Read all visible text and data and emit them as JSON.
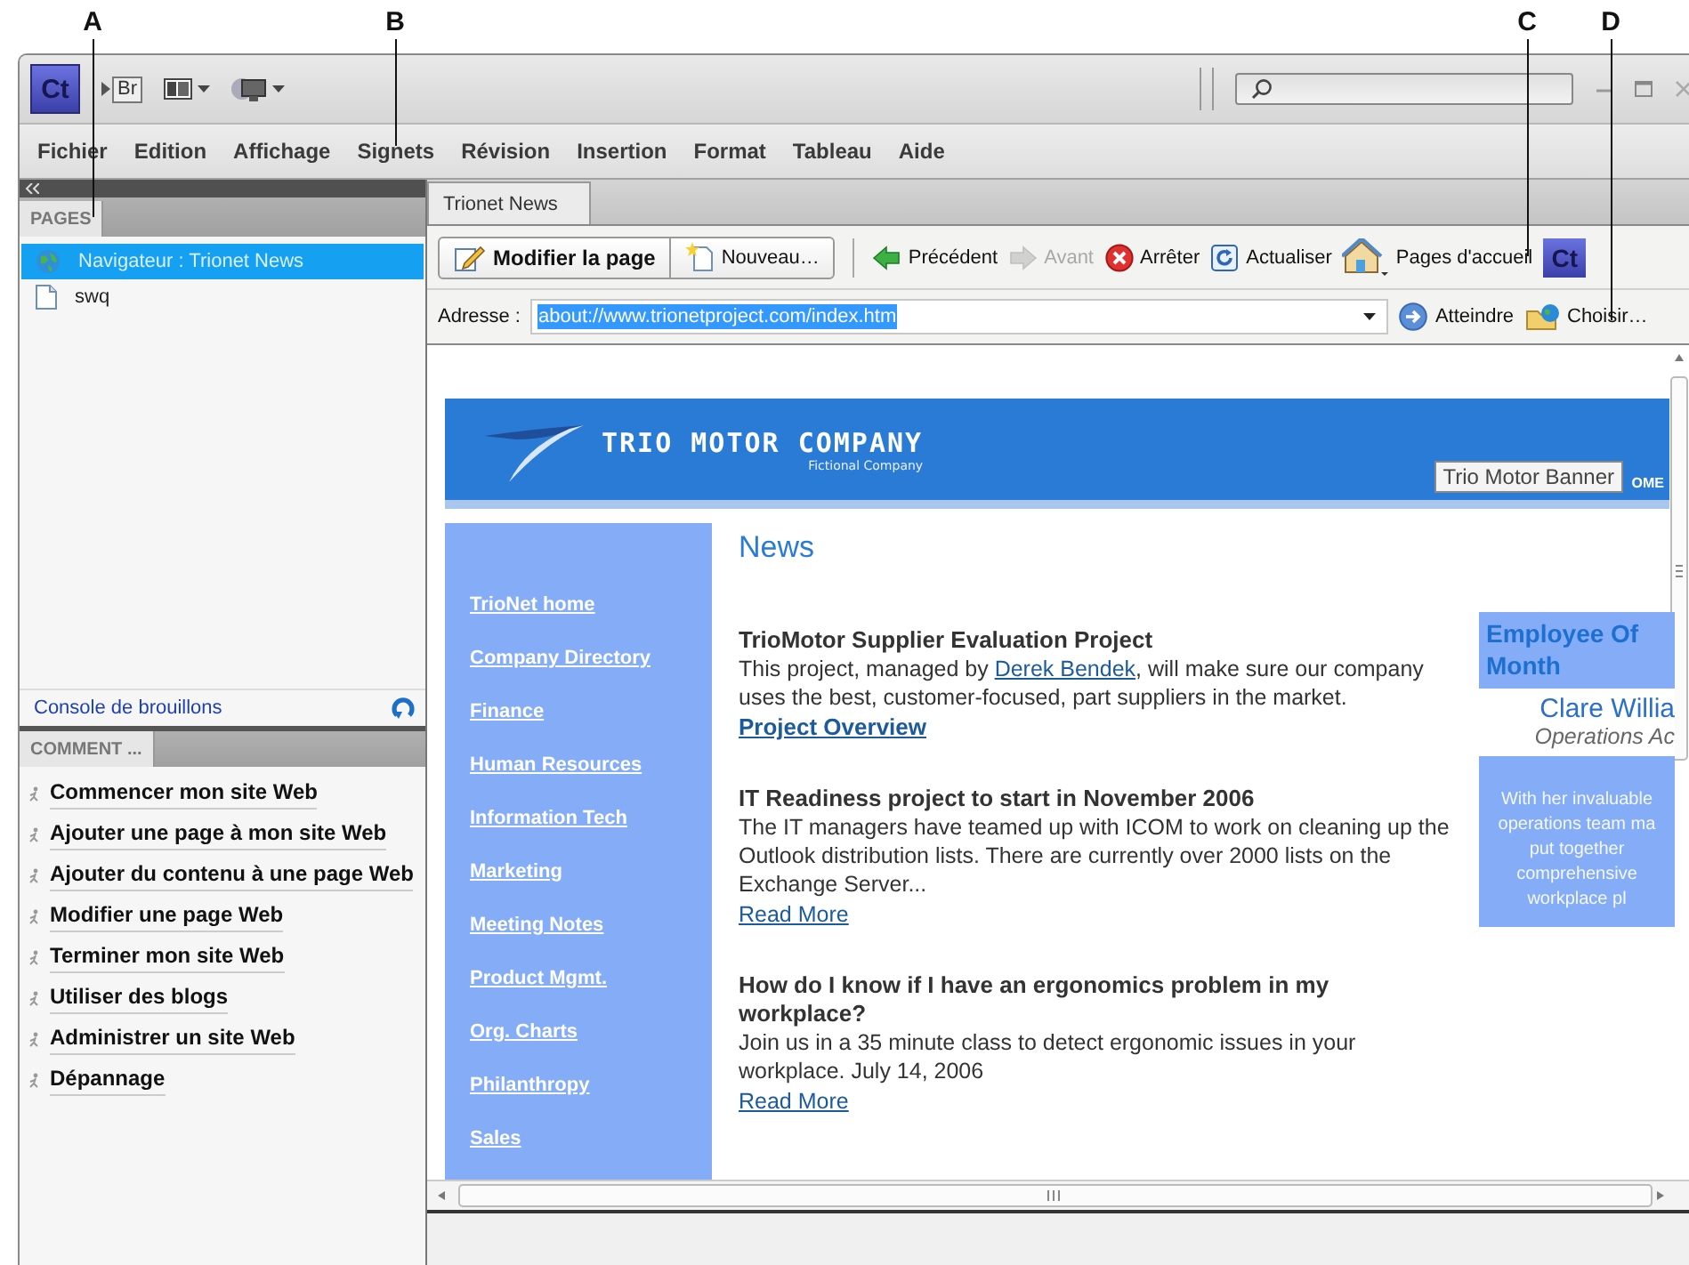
{
  "callouts": [
    {
      "label": "A"
    },
    {
      "label": "B"
    },
    {
      "label": "C"
    },
    {
      "label": "D"
    }
  ],
  "title_bar": {
    "app_logo": "Ct",
    "bridge_button": "Br"
  },
  "menu": [
    "Fichier",
    "Edition",
    "Affichage",
    "Signets",
    "Révision",
    "Insertion",
    "Format",
    "Tableau",
    "Aide"
  ],
  "left_panel": {
    "pages_tab": "PAGES",
    "pages": [
      {
        "label": "Navigateur : Trionet News",
        "kind": "browser",
        "selected": true
      },
      {
        "label": "swq",
        "kind": "page",
        "selected": false
      }
    ],
    "drafts_console": "Console de brouillons",
    "help_tab": "COMMENT ...",
    "help_topics": [
      "Commencer mon site Web",
      "Ajouter une page à mon site Web",
      "Ajouter du contenu à une page Web",
      "Modifier une page Web",
      "Terminer mon site Web",
      "Utiliser des blogs",
      "Administrer un site Web",
      "Dépannage"
    ]
  },
  "document_tab": {
    "label": "Trionet News",
    "selected": true
  },
  "toolbar": [
    {
      "label": "Modifier la page",
      "kind": "edit",
      "disabled": false
    },
    {
      "label": "Nouveau…",
      "kind": "new",
      "disabled": false
    },
    {
      "label": "Précédent",
      "kind": "back",
      "disabled": false
    },
    {
      "label": "Avant",
      "kind": "forward",
      "disabled": true
    },
    {
      "label": "Arrêter",
      "kind": "stop",
      "disabled": false
    },
    {
      "label": "Actualiser",
      "kind": "refresh",
      "disabled": false
    },
    {
      "label": "Pages d'accueil",
      "kind": "home",
      "disabled": false
    }
  ],
  "toolbar_logo": "Ct",
  "address_bar": {
    "label": "Adresse :",
    "value": "about://www.trionetproject.com/index.htm",
    "selected": true,
    "go_button": "Atteindre",
    "choose_button": "Choisir…"
  },
  "web_page": {
    "company": "TRIO MOTOR COMPANY",
    "tagline": "Fictional Company",
    "tooltip": "Trio Motor Banner",
    "banner_fragment": "OME",
    "nav": [
      "TrioNet home",
      "Company Directory",
      "Finance",
      "Human Resources",
      "Information Tech",
      "Marketing",
      "Meeting Notes",
      "Product Mgmt.",
      "Org. Charts",
      "Philanthropy",
      "Sales"
    ],
    "heading": "News",
    "articles": [
      {
        "title": "TrioMotor Supplier Evaluation Project",
        "before": "This project, managed by ",
        "person": "Derek Bendek",
        "after": ", will make sure our company uses the best, customer-focused, part suppliers in the market.",
        "link": {
          "label": "Project Overview",
          "bold": true
        }
      },
      {
        "title": "IT Readiness project to start in November 2006",
        "before": "The IT managers have teamed up with ICOM to work on cleaning up the Outlook distribution lists. There are currently over 2000 lists on the Exchange Server...",
        "link": {
          "label": "Read More",
          "bold": false
        }
      },
      {
        "title": "How do I know if I have an ergonomics problem in my workplace?",
        "before": "Join us in a 35 minute class to detect ergonomic issues in your workplace. July 14, 2006",
        "link": {
          "label": "Read More",
          "bold": false
        }
      }
    ],
    "spotlight": {
      "heading": [
        "Employee Of",
        "Month"
      ],
      "name": "Clare Willia",
      "role": "Operations Ac",
      "lines": [
        "With her invaluable",
        "operations team ma",
        "put together",
        "comprehensive",
        "workplace pl"
      ]
    }
  }
}
